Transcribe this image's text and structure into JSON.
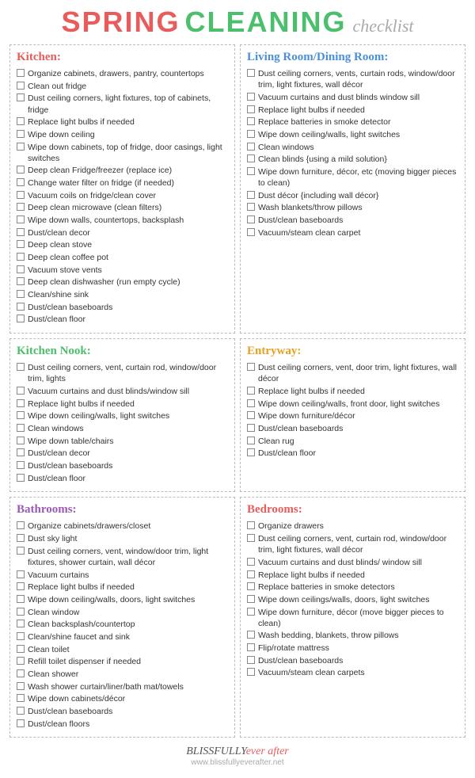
{
  "header": {
    "spring": "SPRING",
    "cleaning": "CLEANING",
    "checklist": "checklist"
  },
  "sections": {
    "kitchen": {
      "title": "Kitchen:",
      "items": [
        "Organize cabinets, drawers, pantry, countertops",
        "Clean out fridge",
        "Dust ceiling corners, light fixtures, top of cabinets, fridge",
        "Replace light bulbs if needed",
        "Wipe down ceiling",
        "Wipe down cabinets, top of fridge, door casings, light switches",
        "Deep clean Fridge/freezer (replace ice)",
        "Change water filter on fridge (if needed)",
        "Vacuum coils on fridge/clean cover",
        "Deep clean microwave (clean filters)",
        "Wipe down walls, countertops, backsplash",
        "Dust/clean decor",
        "Deep clean stove",
        "Deep clean coffee pot",
        "Vacuum stove vents",
        "Deep clean dishwasher (run empty cycle)",
        "Clean/shine sink",
        "Dust/clean baseboards",
        "Dust/clean floor"
      ]
    },
    "living": {
      "title": "Living Room/Dining Room:",
      "items": [
        "Dust ceiling corners, vents, curtain rods, window/door trim, light fixtures, wall décor",
        "Vacuum curtains and dust blinds window sill",
        "Replace light bulbs if needed",
        "Replace batteries in smoke detector",
        "Wipe down ceiling/walls, light switches",
        "Clean windows",
        "Clean blinds {using a mild solution}",
        "Wipe down furniture, décor, etc (moving bigger pieces to clean)",
        "Dust décor {including wall décor}",
        "Wash blankets/throw pillows",
        "Dust/clean baseboards",
        "Vacuum/steam clean carpet"
      ]
    },
    "kitchen_nook": {
      "title": "Kitchen Nook:",
      "items": [
        "Dust ceiling corners, vent, curtain rod, window/door trim, lights",
        "Vacuum curtains and dust blinds/window sill",
        "Replace light bulbs if needed",
        "Wipe down ceiling/walls, light switches",
        "Clean windows",
        "Wipe down table/chairs",
        "Dust/clean decor",
        "Dust/clean baseboards",
        "Dust/clean floor"
      ]
    },
    "entryway": {
      "title": "Entryway:",
      "items": [
        "Dust ceiling corners, vent, door trim, light fixtures, wall décor",
        "Replace light bulbs if needed",
        "Wipe down ceiling/walls, front door, light switches",
        "Wipe down furniture/décor",
        "Dust/clean baseboards",
        "Clean rug",
        "Dust/clean floor"
      ]
    },
    "bathrooms": {
      "title": "Bathrooms:",
      "items": [
        "Organize cabinets/drawers/closet",
        "Dust sky light",
        "Dust ceiling corners, vent, window/door trim, light fixtures, shower curtain, wall décor",
        "Vacuum curtains",
        "Replace light bulbs if needed",
        "Wipe down ceiling/walls, doors, light switches",
        "Clean window",
        "Clean backsplash/countertop",
        "Clean/shine faucet and sink",
        "Clean toilet",
        "Refill toilet dispenser if needed",
        "Clean shower",
        "Wash shower curtain/liner/bath mat/towels",
        "Wipe down cabinets/décor",
        "Dust/clean baseboards",
        "Dust/clean floors"
      ]
    },
    "bedrooms": {
      "title": "Bedrooms:",
      "items": [
        "Organize drawers",
        "Dust ceiling corners, vent, curtain rod, window/door trim, light fixtures, wall décor",
        "Vacuum curtains and dust blinds/ window sill",
        "Replace light bulbs if needed",
        "Replace batteries in smoke detectors",
        "Wipe down ceilings/walls, doors, light switches",
        "Wipe down furniture, décor (move bigger pieces to clean)",
        "Wash bedding, blankets, throw pillows",
        "Flip/rotate mattress",
        "Dust/clean baseboards",
        "Vacuum/steam clean carpets"
      ]
    }
  },
  "footer": {
    "blissfully": "BLISSFULLY",
    "ever_after": "ever after",
    "url": "www.blissfullyeverafter.net"
  }
}
